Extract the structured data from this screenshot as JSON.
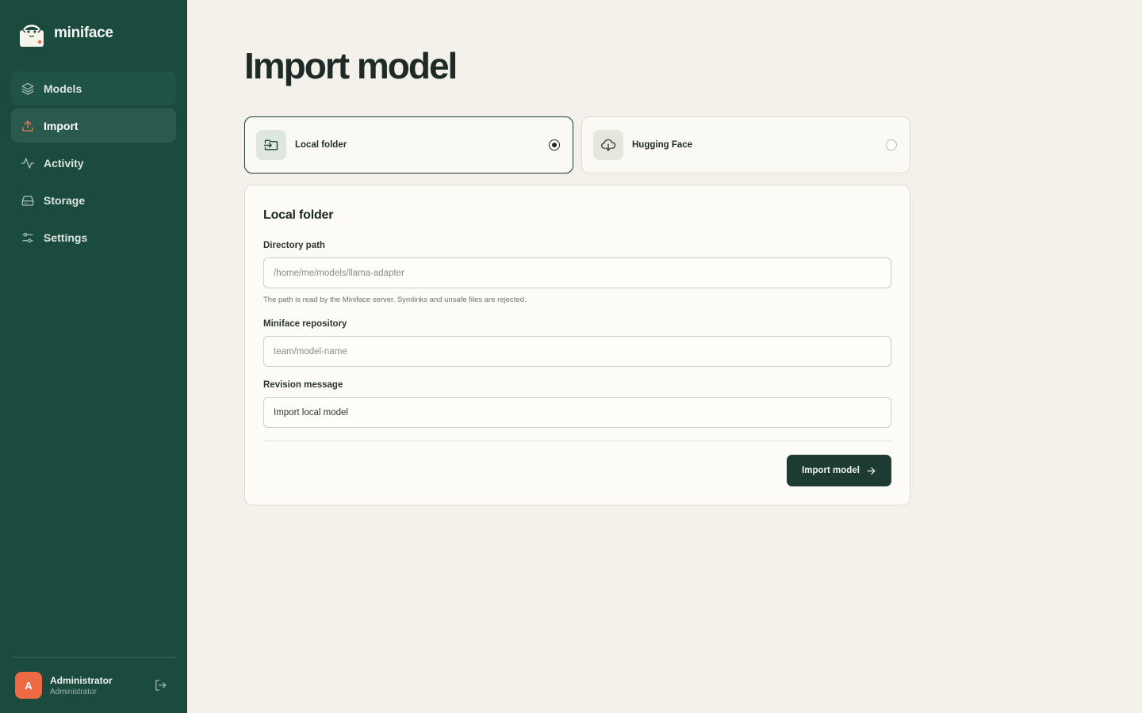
{
  "app": {
    "name": "miniface",
    "logo_icon": "miniface-logo-icon"
  },
  "sidebar": {
    "items": [
      {
        "label": "Models",
        "icon": "layers-icon",
        "state": "hover"
      },
      {
        "label": "Import",
        "icon": "upload-icon",
        "state": "active"
      },
      {
        "label": "Activity",
        "icon": "activity-icon",
        "state": ""
      },
      {
        "label": "Storage",
        "icon": "hard-drive-icon",
        "state": ""
      },
      {
        "label": "Settings",
        "icon": "sliders-icon",
        "state": ""
      }
    ]
  },
  "user": {
    "initial": "A",
    "name": "Administrator",
    "role": "Administrator",
    "avatar_color": "#ee6a45",
    "logout_icon": "log-out-icon"
  },
  "main": {
    "title": "Import model",
    "sources": [
      {
        "label": "Local folder",
        "icon": "folder-import-icon",
        "selected": true
      },
      {
        "label": "Hugging Face",
        "icon": "cloud-download-icon",
        "selected": false
      }
    ],
    "form": {
      "title": "Local folder",
      "directory": {
        "label": "Directory path",
        "placeholder": "/home/me/models/llama-adapter",
        "value": "",
        "hint": "The path is read by the Miniface server. Symlinks and unsafe files are rejected."
      },
      "repository": {
        "label": "Miniface repository",
        "placeholder": "team/model-name",
        "value": ""
      },
      "revision": {
        "label": "Revision message",
        "placeholder": "",
        "value": "Import local model"
      },
      "submit_label": "Import model",
      "submit_icon": "arrow-right-icon"
    }
  },
  "colors": {
    "sidebar_bg": "#1b4a3e",
    "page_bg": "#f3f1ea",
    "primary_button": "#1d3a33",
    "accent": "#ee6a45"
  }
}
